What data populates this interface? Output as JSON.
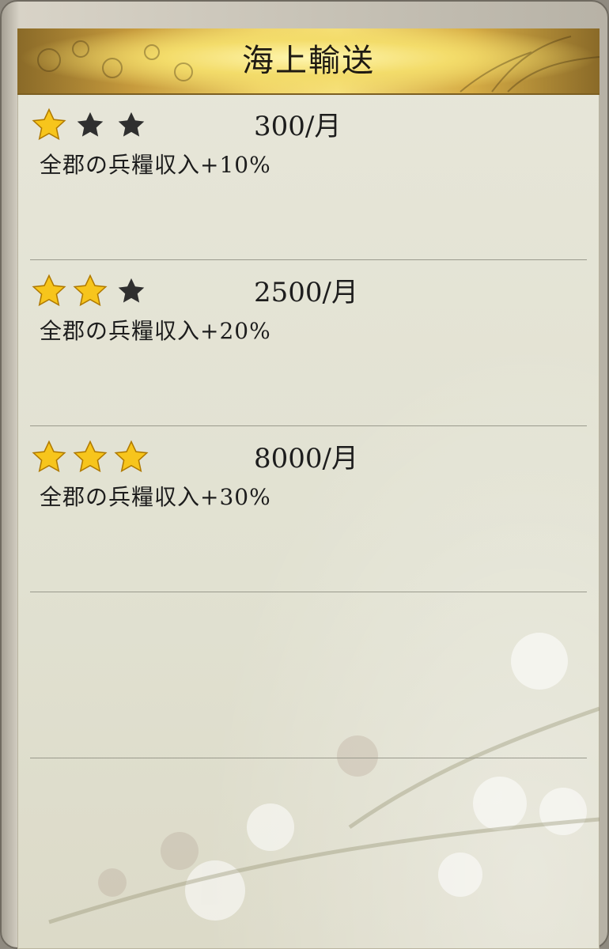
{
  "panel": {
    "title": "海上輸送"
  },
  "tiers": [
    {
      "stars_filled": 1,
      "stars_total": 3,
      "cost": "300/月",
      "effect": "全郡の兵糧収入+10%"
    },
    {
      "stars_filled": 2,
      "stars_total": 3,
      "cost": "2500/月",
      "effect": "全郡の兵糧収入+20%"
    },
    {
      "stars_filled": 3,
      "stars_total": 3,
      "cost": "8000/月",
      "effect": "全郡の兵糧収入+30%"
    }
  ],
  "colors": {
    "gold_star": "#f7c51c",
    "empty_star": "#2f2f2f",
    "header_gold": "#f0d468",
    "panel_bg": "#e3e2d4",
    "divider": "#9a9a8d"
  },
  "icons": [
    "star-filled-icon",
    "star-empty-icon",
    "cherry-blossom-decoration"
  ]
}
